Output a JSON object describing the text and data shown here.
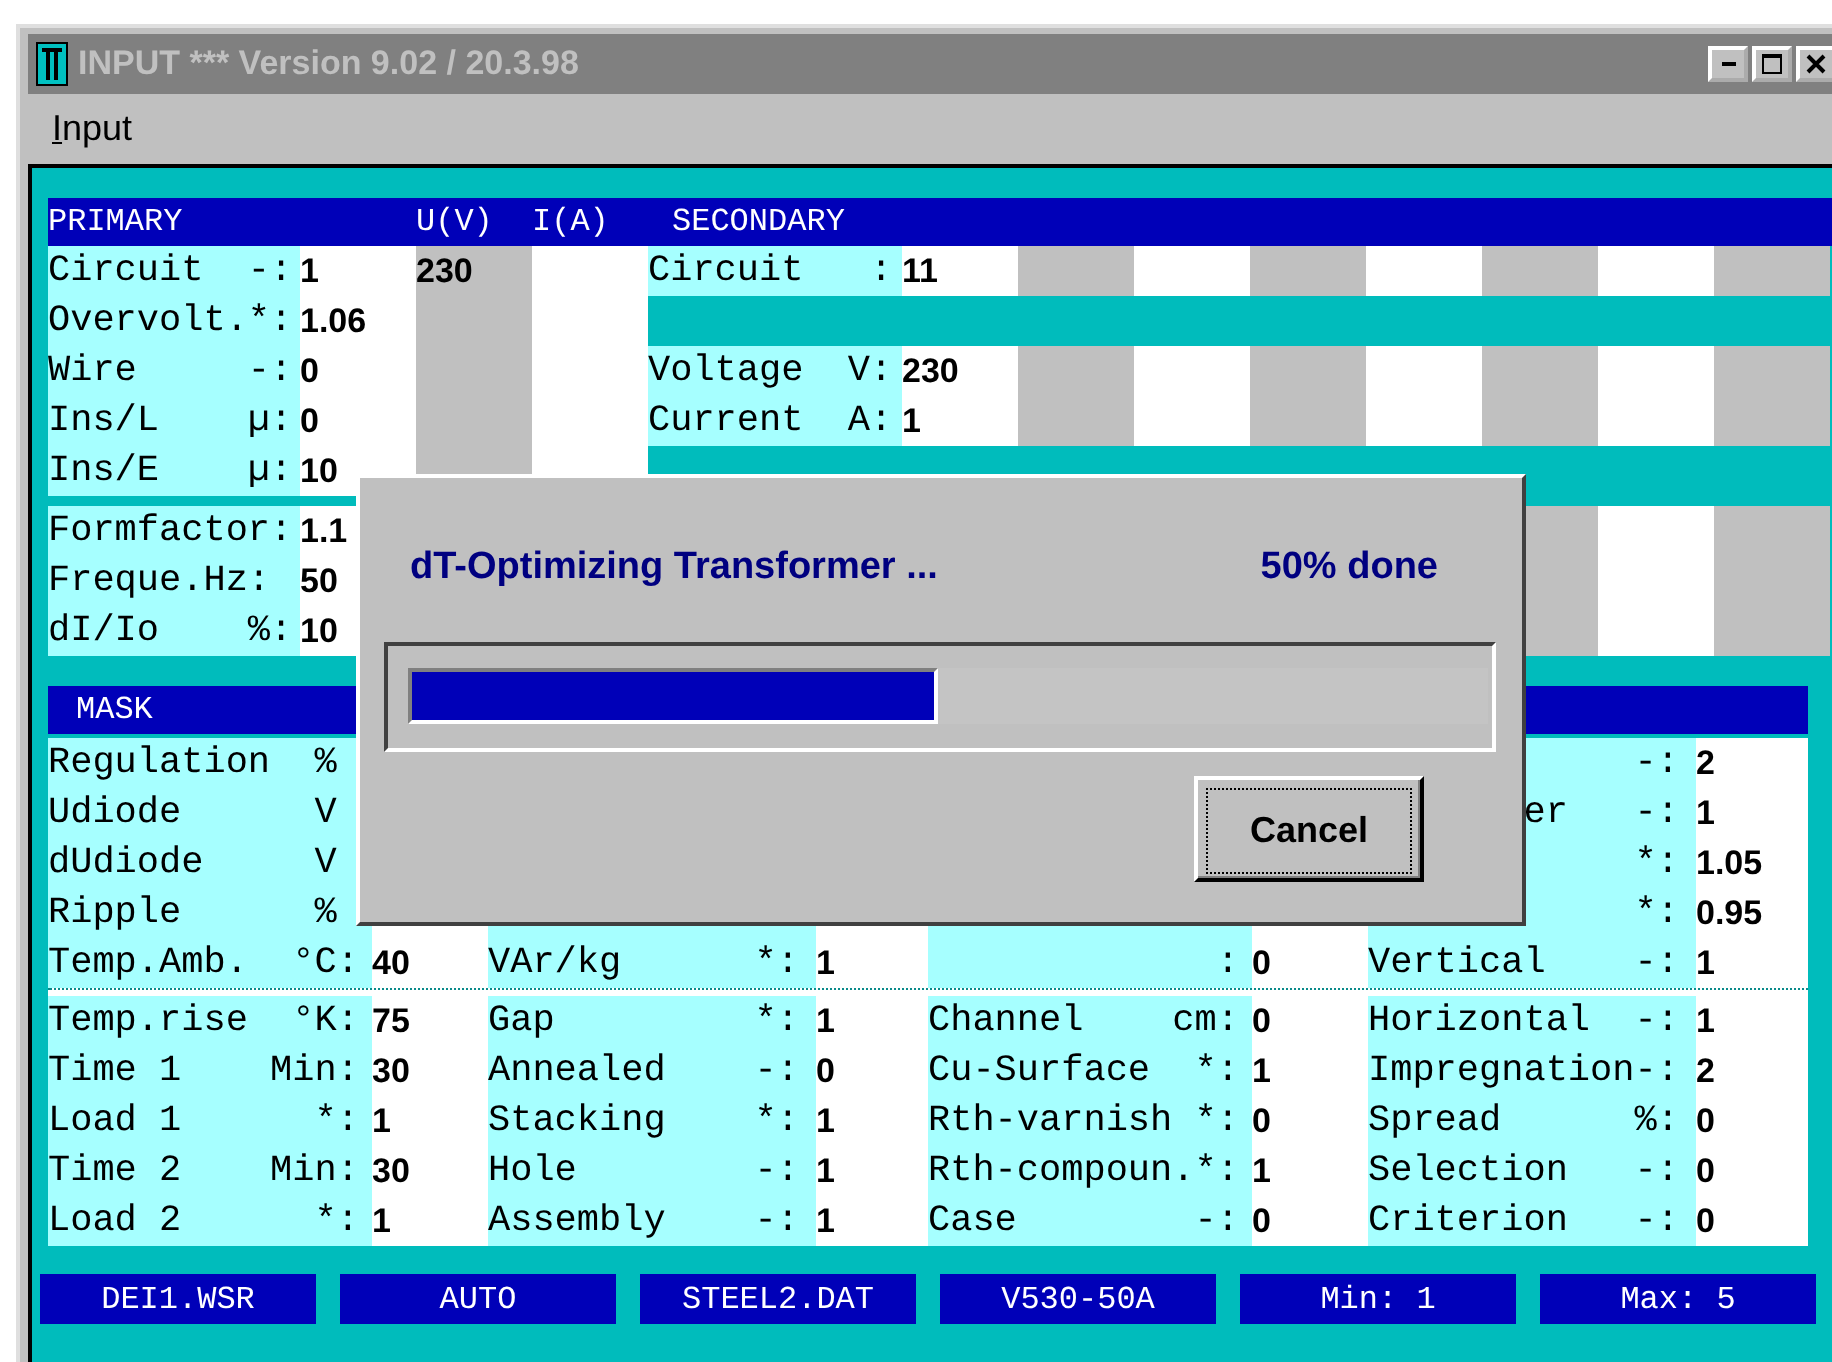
{
  "window": {
    "title": "INPUT *** Version 9.02 / 20.3.98"
  },
  "menu": [
    {
      "label": "Input"
    }
  ],
  "primary": {
    "headers": [
      "PRIMARY",
      "U(V)",
      "I(A)"
    ],
    "rows": [
      {
        "label": "Circuit  -:",
        "value": "1",
        "voltage": "230"
      },
      {
        "label": "Overvolt.*:",
        "value": "1.06"
      },
      {
        "label": "Wire     -:",
        "value": "0"
      },
      {
        "label": "Ins/L    µ:",
        "value": "0"
      },
      {
        "label": "Ins/E    µ:",
        "value": "10"
      }
    ],
    "extra_rows": [
      {
        "label": "Formfactor:",
        "value": "1.1"
      },
      {
        "label": "Freque.Hz:",
        "value": "50"
      },
      {
        "label": "dI/Io    %:",
        "value": "10"
      }
    ]
  },
  "secondary": {
    "header": "SECONDARY",
    "groups": [
      [
        {
          "label": "Circuit   :",
          "value": "11"
        }
      ],
      [
        {
          "label": "Voltage  V:",
          "value": "230"
        },
        {
          "label": "Current  A:",
          "value": "1"
        }
      ]
    ]
  },
  "mask": {
    "title": "MASK",
    "upper_rows": [
      [
        {
          "label": "Regulation  %"
        },
        {},
        {},
        {
          "label": "            -:",
          "value": "2"
        }
      ],
      [
        {
          "label": "Udiode      V"
        },
        {},
        {},
        {
          "label": "       er   -:",
          "value": "1"
        }
      ],
      [
        {
          "label": "dUdiode     V"
        },
        {},
        {},
        {
          "label": "            *:",
          "value": "1.05"
        }
      ],
      [
        {
          "label": "Ripple      %"
        },
        {},
        {},
        {
          "label": "            *:",
          "value": "0.95"
        }
      ],
      [
        {
          "label": "Temp.Amb.  °C:",
          "value": "40"
        },
        {
          "label": "VAr/kg      *:",
          "value": "1"
        },
        {
          "label": "             :",
          "value": "0"
        },
        {
          "label": "Vertical    -:",
          "value": "1"
        }
      ]
    ],
    "lower_rows": [
      [
        {
          "label": "Temp.rise  °K:",
          "value": "75"
        },
        {
          "label": "Gap         *:",
          "value": "1"
        },
        {
          "label": "Channel    cm:",
          "value": "0"
        },
        {
          "label": "Horizontal  -:",
          "value": "1"
        }
      ],
      [
        {
          "label": "Time 1    Min:",
          "value": "30"
        },
        {
          "label": "Annealed    -:",
          "value": "0"
        },
        {
          "label": "Cu-Surface  *:",
          "value": "1"
        },
        {
          "label": "Impregnation-:",
          "value": "2"
        }
      ],
      [
        {
          "label": "Load 1      *:",
          "value": "1"
        },
        {
          "label": "Stacking    *:",
          "value": "1"
        },
        {
          "label": "Rth-varnish *:",
          "value": "0"
        },
        {
          "label": "Spread      %:",
          "value": "0"
        }
      ],
      [
        {
          "label": "Time 2    Min:",
          "value": "30"
        },
        {
          "label": "Hole        -:",
          "value": "1"
        },
        {
          "label": "Rth-compoun.*:",
          "value": "1"
        },
        {
          "label": "Selection   -:",
          "value": "0"
        }
      ],
      [
        {
          "label": "Load 2      *:",
          "value": "1"
        },
        {
          "label": "Assembly    -:",
          "value": "1"
        },
        {
          "label": "Case        -:",
          "value": "0"
        },
        {
          "label": "Criterion   -:",
          "value": "0"
        }
      ]
    ]
  },
  "status_bar": [
    "DEI1.WSR",
    "AUTO",
    "STEEL2.DAT",
    "V530-50A",
    "Min: 1",
    "Max: 5"
  ],
  "dialog": {
    "title": "dT-Optimizing Transformer ...",
    "status": "50% done",
    "progress": {
      "level": 0.49
    },
    "button": "Cancel"
  }
}
